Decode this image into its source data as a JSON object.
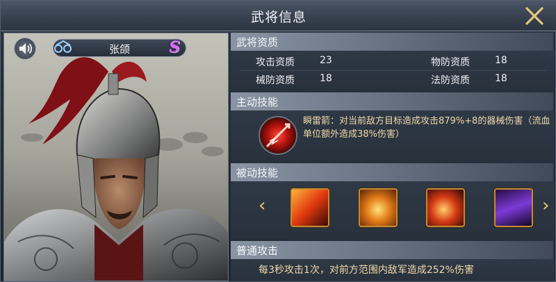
{
  "window": {
    "title": "武将信息"
  },
  "hero": {
    "name": "张颌",
    "rank": "S"
  },
  "attributes": {
    "header": "武将资质",
    "stats": [
      {
        "label": "攻击资质",
        "value": "23"
      },
      {
        "label": "物防资质",
        "value": "18"
      },
      {
        "label": "械防资质",
        "value": "18"
      },
      {
        "label": "法防资质",
        "value": "18"
      }
    ]
  },
  "active_skill": {
    "header": "主动技能",
    "description": "瞬雷箭：对当前敌方目标造成攻击879%+8的器械伤害（流血单位额外造成38%伤害）"
  },
  "passive_skills": {
    "header": "被动技能",
    "prev_arrow": "‹",
    "next_arrow": "›",
    "icons": [
      "passive-skill-1-icon",
      "passive-skill-2-icon",
      "passive-skill-3-icon",
      "passive-skill-4-icon"
    ]
  },
  "normal_attack": {
    "header": "普通攻击",
    "description": "每3秒攻击1次，对前方范围内敌军造成252%伤害"
  },
  "colors": {
    "accent_gold": "#f1d9a8",
    "rank_purple": "#d36cf2",
    "skill_frame": "#c28c3a"
  }
}
